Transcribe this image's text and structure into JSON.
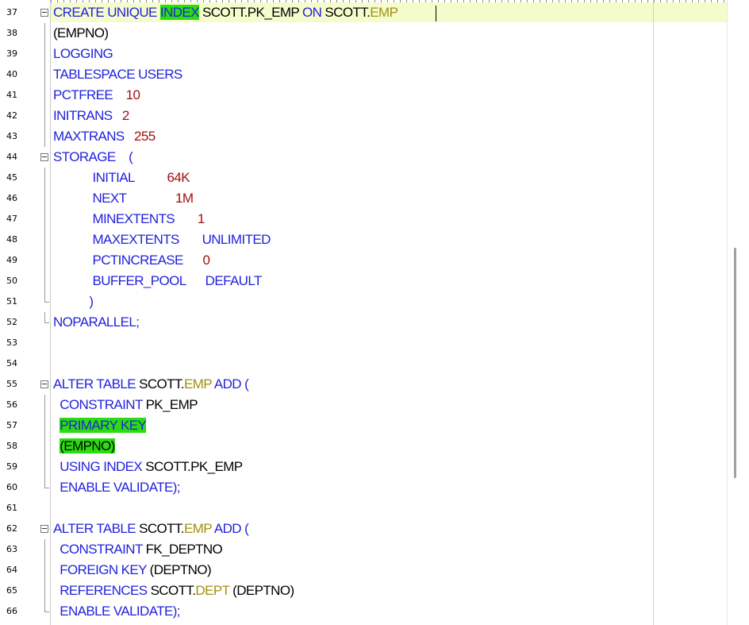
{
  "editor": {
    "lines": [
      {
        "n": "37",
        "fold": "start",
        "tokens": [
          {
            "t": "CREATE UNIQUE ",
            "c": "kw"
          },
          {
            "t": "INDEX",
            "c": "kw",
            "hl": true
          },
          {
            "t": " SCOTT.PK_EMP ",
            "c": "id"
          },
          {
            "t": "ON",
            "c": "kw"
          },
          {
            "t": " SCOTT.",
            "c": "id"
          },
          {
            "t": "EMP",
            "c": "tb"
          }
        ]
      },
      {
        "n": "38",
        "fold": "mid",
        "tokens": [
          {
            "t": "(EMPNO)",
            "c": "id"
          }
        ]
      },
      {
        "n": "39",
        "fold": "mid",
        "tokens": [
          {
            "t": "LOGGING",
            "c": "kw"
          }
        ]
      },
      {
        "n": "40",
        "fold": "mid",
        "tokens": [
          {
            "t": "TABLESPACE USERS",
            "c": "kw"
          }
        ]
      },
      {
        "n": "41",
        "fold": "mid",
        "tokens": [
          {
            "t": "PCTFREE    ",
            "c": "kw"
          },
          {
            "t": "10",
            "c": "num"
          }
        ]
      },
      {
        "n": "42",
        "fold": "mid",
        "tokens": [
          {
            "t": "INITRANS   ",
            "c": "kw"
          },
          {
            "t": "2",
            "c": "num"
          }
        ]
      },
      {
        "n": "43",
        "fold": "mid",
        "tokens": [
          {
            "t": "MAXTRANS   ",
            "c": "kw"
          },
          {
            "t": "255",
            "c": "num"
          }
        ]
      },
      {
        "n": "44",
        "fold": "start",
        "tokens": [
          {
            "t": "STORAGE    (",
            "c": "kw"
          }
        ]
      },
      {
        "n": "45",
        "fold": "mid",
        "tokens": [
          {
            "t": "            INITIAL          ",
            "c": "kw"
          },
          {
            "t": "64K",
            "c": "num"
          }
        ]
      },
      {
        "n": "46",
        "fold": "mid",
        "tokens": [
          {
            "t": "            NEXT               ",
            "c": "kw"
          },
          {
            "t": "1M",
            "c": "num"
          }
        ]
      },
      {
        "n": "47",
        "fold": "mid",
        "tokens": [
          {
            "t": "            MINEXTENTS       ",
            "c": "kw"
          },
          {
            "t": "1",
            "c": "num"
          }
        ]
      },
      {
        "n": "48",
        "fold": "mid",
        "tokens": [
          {
            "t": "            MAXEXTENTS       UNLIMITED",
            "c": "kw"
          }
        ]
      },
      {
        "n": "49",
        "fold": "mid",
        "tokens": [
          {
            "t": "            PCTINCREASE      ",
            "c": "kw"
          },
          {
            "t": "0",
            "c": "num"
          }
        ]
      },
      {
        "n": "50",
        "fold": "mid",
        "tokens": [
          {
            "t": "            BUFFER_POOL      DEFAULT",
            "c": "kw"
          }
        ]
      },
      {
        "n": "51",
        "fold": "end",
        "tokens": [
          {
            "t": "           )",
            "c": "kw"
          }
        ]
      },
      {
        "n": "52",
        "fold": "end",
        "tokens": [
          {
            "t": "NOPARALLEL;",
            "c": "kw"
          }
        ]
      },
      {
        "n": "53",
        "fold": "",
        "tokens": []
      },
      {
        "n": "54",
        "fold": "",
        "tokens": []
      },
      {
        "n": "55",
        "fold": "start",
        "tokens": [
          {
            "t": "ALTER TABLE ",
            "c": "kw"
          },
          {
            "t": "SCOTT.",
            "c": "id"
          },
          {
            "t": "EMP",
            "c": "tb"
          },
          {
            "t": " ADD (",
            "c": "kw"
          }
        ]
      },
      {
        "n": "56",
        "fold": "mid",
        "tokens": [
          {
            "t": "  CONSTRAINT ",
            "c": "kw"
          },
          {
            "t": "PK_EMP",
            "c": "id"
          }
        ]
      },
      {
        "n": "57",
        "fold": "mid",
        "tokens": [
          {
            "t": "  ",
            "c": "kw"
          },
          {
            "t": "PRIMARY KEY",
            "c": "kw",
            "hl": true
          }
        ]
      },
      {
        "n": "58",
        "fold": "mid",
        "tokens": [
          {
            "t": "  ",
            "c": "kw"
          },
          {
            "t": "(EMPNO)",
            "c": "id",
            "hl": true
          }
        ]
      },
      {
        "n": "59",
        "fold": "mid",
        "tokens": [
          {
            "t": "  USING INDEX ",
            "c": "kw"
          },
          {
            "t": "SCOTT.PK_EMP",
            "c": "id"
          }
        ]
      },
      {
        "n": "60",
        "fold": "end",
        "tokens": [
          {
            "t": "  ENABLE VALIDATE);",
            "c": "kw"
          }
        ]
      },
      {
        "n": "61",
        "fold": "",
        "tokens": []
      },
      {
        "n": "62",
        "fold": "start",
        "tokens": [
          {
            "t": "ALTER TABLE ",
            "c": "kw"
          },
          {
            "t": "SCOTT.",
            "c": "id"
          },
          {
            "t": "EMP",
            "c": "tb"
          },
          {
            "t": " ADD (",
            "c": "kw"
          }
        ]
      },
      {
        "n": "63",
        "fold": "mid",
        "tokens": [
          {
            "t": "  CONSTRAINT ",
            "c": "kw"
          },
          {
            "t": "FK_DEPTNO",
            "c": "id"
          }
        ]
      },
      {
        "n": "64",
        "fold": "mid",
        "tokens": [
          {
            "t": "  FOREIGN KEY ",
            "c": "kw"
          },
          {
            "t": "(DEPTNO)",
            "c": "id"
          }
        ]
      },
      {
        "n": "65",
        "fold": "mid",
        "tokens": [
          {
            "t": "  REFERENCES ",
            "c": "kw"
          },
          {
            "t": "SCOTT.",
            "c": "id"
          },
          {
            "t": "DEPT",
            "c": "tb"
          },
          {
            "t": " (DEPTNO)",
            "c": "id"
          }
        ]
      },
      {
        "n": "66",
        "fold": "end",
        "tokens": [
          {
            "t": "  ENABLE VALIDATE);",
            "c": "kw"
          }
        ]
      }
    ]
  },
  "colors": {
    "keyword": "#2222dd",
    "identifier": "#000000",
    "table_name": "#a09010",
    "number": "#a01010",
    "match_highlight": "#2bdc10",
    "current_line": "#f5fccc"
  }
}
